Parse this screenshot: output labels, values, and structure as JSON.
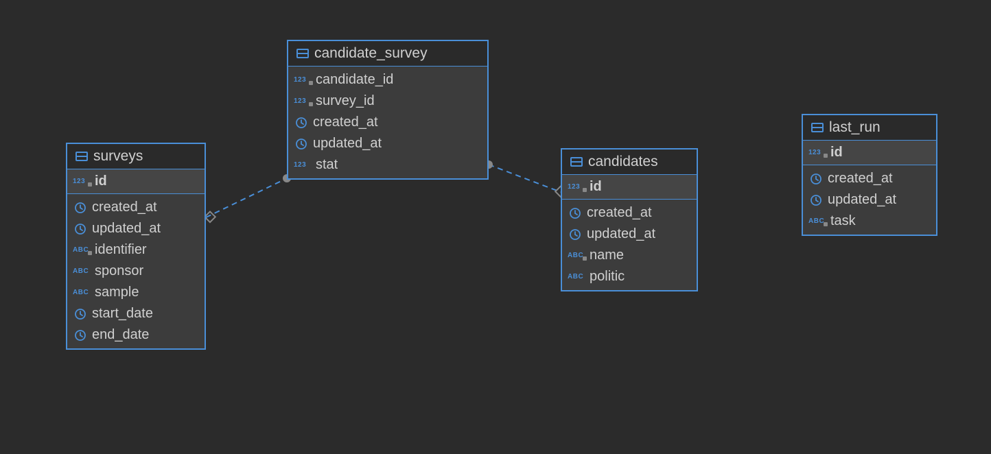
{
  "tables": {
    "surveys": {
      "name": "surveys",
      "pk": {
        "icon": "123k",
        "name": "id"
      },
      "columns": [
        {
          "icon": "clock",
          "name": "created_at"
        },
        {
          "icon": "clock",
          "name": "updated_at"
        },
        {
          "icon": "abck",
          "name": "identifier"
        },
        {
          "icon": "abc",
          "name": "sponsor"
        },
        {
          "icon": "abc",
          "name": "sample"
        },
        {
          "icon": "clock",
          "name": "start_date"
        },
        {
          "icon": "clock",
          "name": "end_date"
        }
      ]
    },
    "candidate_survey": {
      "name": "candidate_survey",
      "pk": null,
      "columns": [
        {
          "icon": "123f",
          "name": "candidate_id"
        },
        {
          "icon": "123f",
          "name": "survey_id"
        },
        {
          "icon": "clock",
          "name": "created_at"
        },
        {
          "icon": "clock",
          "name": "updated_at"
        },
        {
          "icon": "123",
          "name": "stat"
        }
      ]
    },
    "candidates": {
      "name": "candidates",
      "pk": {
        "icon": "123k",
        "name": "id"
      },
      "columns": [
        {
          "icon": "clock",
          "name": "created_at"
        },
        {
          "icon": "clock",
          "name": "updated_at"
        },
        {
          "icon": "abck",
          "name": "name"
        },
        {
          "icon": "abc",
          "name": "politic"
        }
      ]
    },
    "last_run": {
      "name": "last_run",
      "pk": {
        "icon": "123k",
        "name": "id"
      },
      "columns": [
        {
          "icon": "clock",
          "name": "created_at"
        },
        {
          "icon": "clock",
          "name": "updated_at"
        },
        {
          "icon": "abck",
          "name": "task"
        }
      ]
    }
  },
  "relations": [
    {
      "from": "candidate_survey.survey_id",
      "to": "surveys.id"
    },
    {
      "from": "candidate_survey.candidate_id",
      "to": "candidates.id"
    }
  ],
  "colors": {
    "border": "#4a8fd8",
    "bg": "#2b2b2b",
    "panel": "#3c3c3c",
    "header": "#2a2a2a"
  }
}
